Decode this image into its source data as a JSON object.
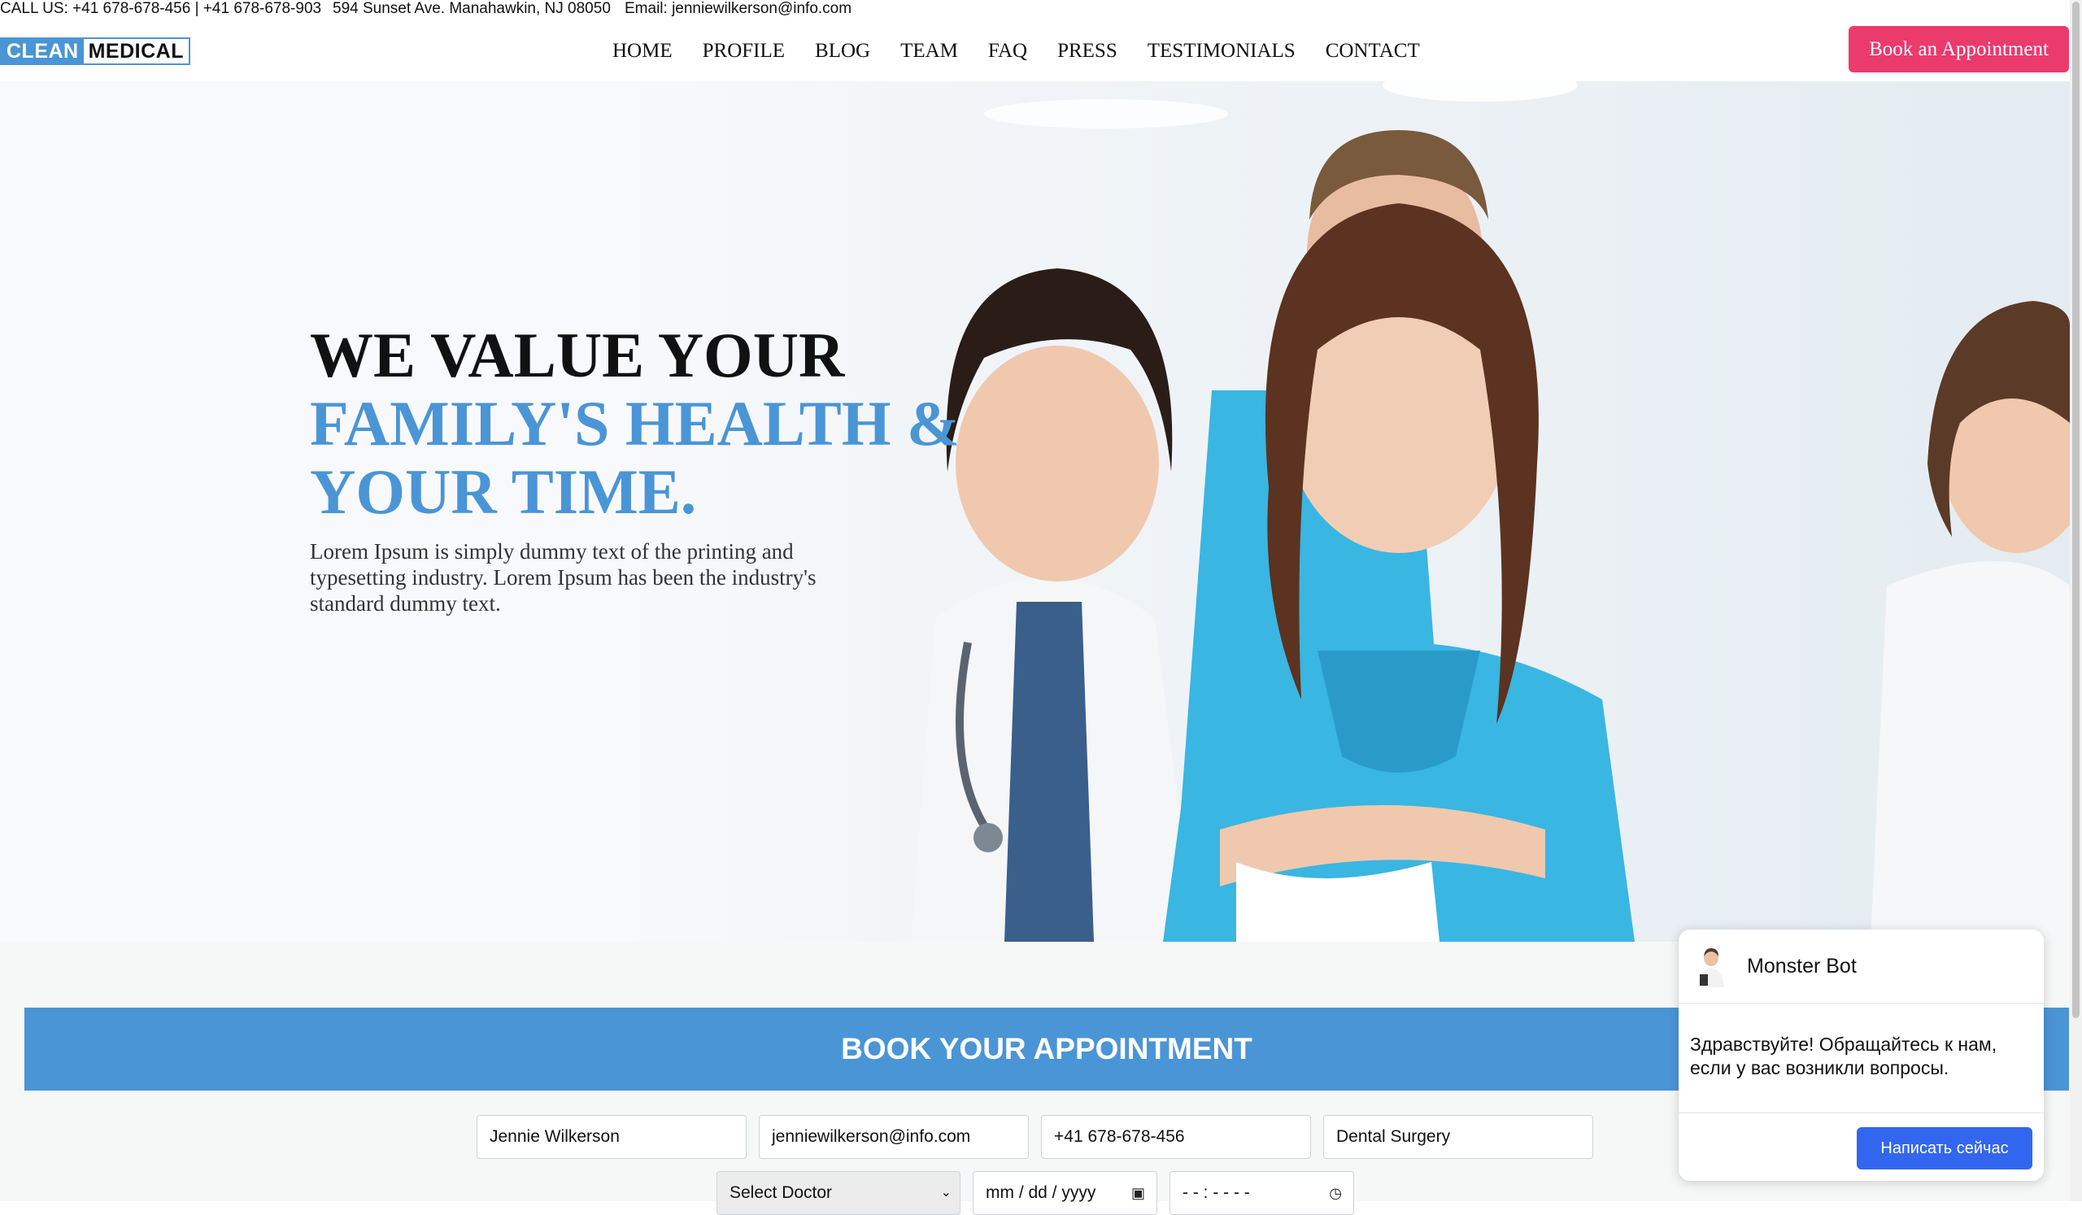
{
  "topbar": {
    "call": "CALL US: +41 678-678-456 | +41 678-678-903",
    "address": "594 Sunset Ave. Manahawkin, NJ 08050",
    "email": "Email: jenniewilkerson@info.com"
  },
  "logo": {
    "part1": "CLEAN",
    "part2": "MEDICAL"
  },
  "nav": [
    "HOME",
    "PROFILE",
    "BLOG",
    "TEAM",
    "FAQ",
    "PRESS",
    "TESTIMONIALS",
    "CONTACT"
  ],
  "header": {
    "book_button": "Book an Appointment"
  },
  "hero": {
    "line1": "WE VALUE YOUR",
    "line2": "FAMILY'S HEALTH &",
    "line3": "YOUR TIME.",
    "description": "Lorem Ipsum is simply dummy text of the printing and typesetting industry. Lorem Ipsum has been the industry's standard dummy text."
  },
  "booking": {
    "title": "BOOK YOUR APPOINTMENT",
    "name_value": "Jennie Wilkerson",
    "email_value": "jenniewilkerson@info.com",
    "phone_value": "+41 678-678-456",
    "department_value": "Dental Surgery",
    "doctor_select": "Select Doctor",
    "date_placeholder": "mm / dd / yyyy",
    "time_placeholder": "- - : - -   - -"
  },
  "chat": {
    "bot_name": "Monster Bot",
    "message": "Здравствуйте! Обращайтесь к нам, если у вас возникли вопросы.",
    "button": "Написать сейчас"
  },
  "colors": {
    "accent_blue": "#4a95d6",
    "cta_pink": "#eb3a6c",
    "chat_button": "#3366ee"
  },
  "icons": {
    "select_caret": "chevron-down-icon",
    "calendar": "calendar-icon",
    "clock": "clock-icon"
  }
}
